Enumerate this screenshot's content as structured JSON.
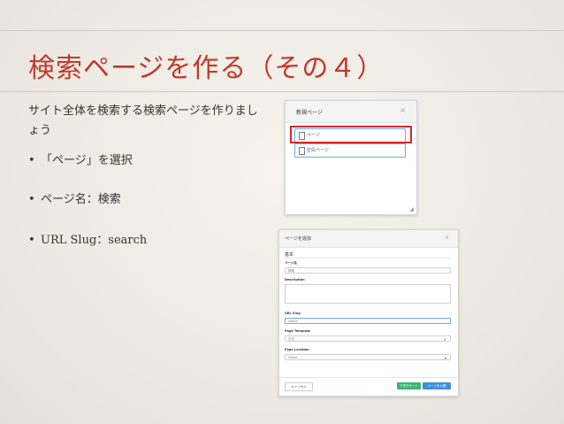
{
  "slide": {
    "title": "検索ページを作る（その４）",
    "intro": "サイト全体を検索する検索ページを作りましょう",
    "bullets": [
      "「ページ」を選択",
      "ページ名：検索",
      "URL Slug：search"
    ],
    "bullet_symbol": "•"
  },
  "dialog1": {
    "title": "新規ページ",
    "close": "×",
    "items": [
      "ページ",
      "空白ページ"
    ],
    "highlighted_item": "ページ",
    "highlight_color": "#d42a2a"
  },
  "dialog2": {
    "title": "ページを追加",
    "close": "×",
    "section": "基本",
    "fields": {
      "page_name": {
        "label": "ページ名",
        "value": "検索"
      },
      "description": {
        "label": "Description",
        "value": ""
      },
      "url_slug": {
        "label": "URL Slug",
        "value": "search"
      },
      "page_template": {
        "label": "Page Template",
        "value": "空白"
      },
      "page_location": {
        "label": "Page Location",
        "value": "Home"
      }
    },
    "buttons": {
      "cancel": "キャンセル",
      "draft": "下書きモード",
      "publish": "ページを公開"
    },
    "colors": {
      "draft": "#3cb371",
      "publish": "#3a8fd8"
    }
  },
  "colors": {
    "title": "#c0392b",
    "accent_blue": "#6fa8dc"
  }
}
